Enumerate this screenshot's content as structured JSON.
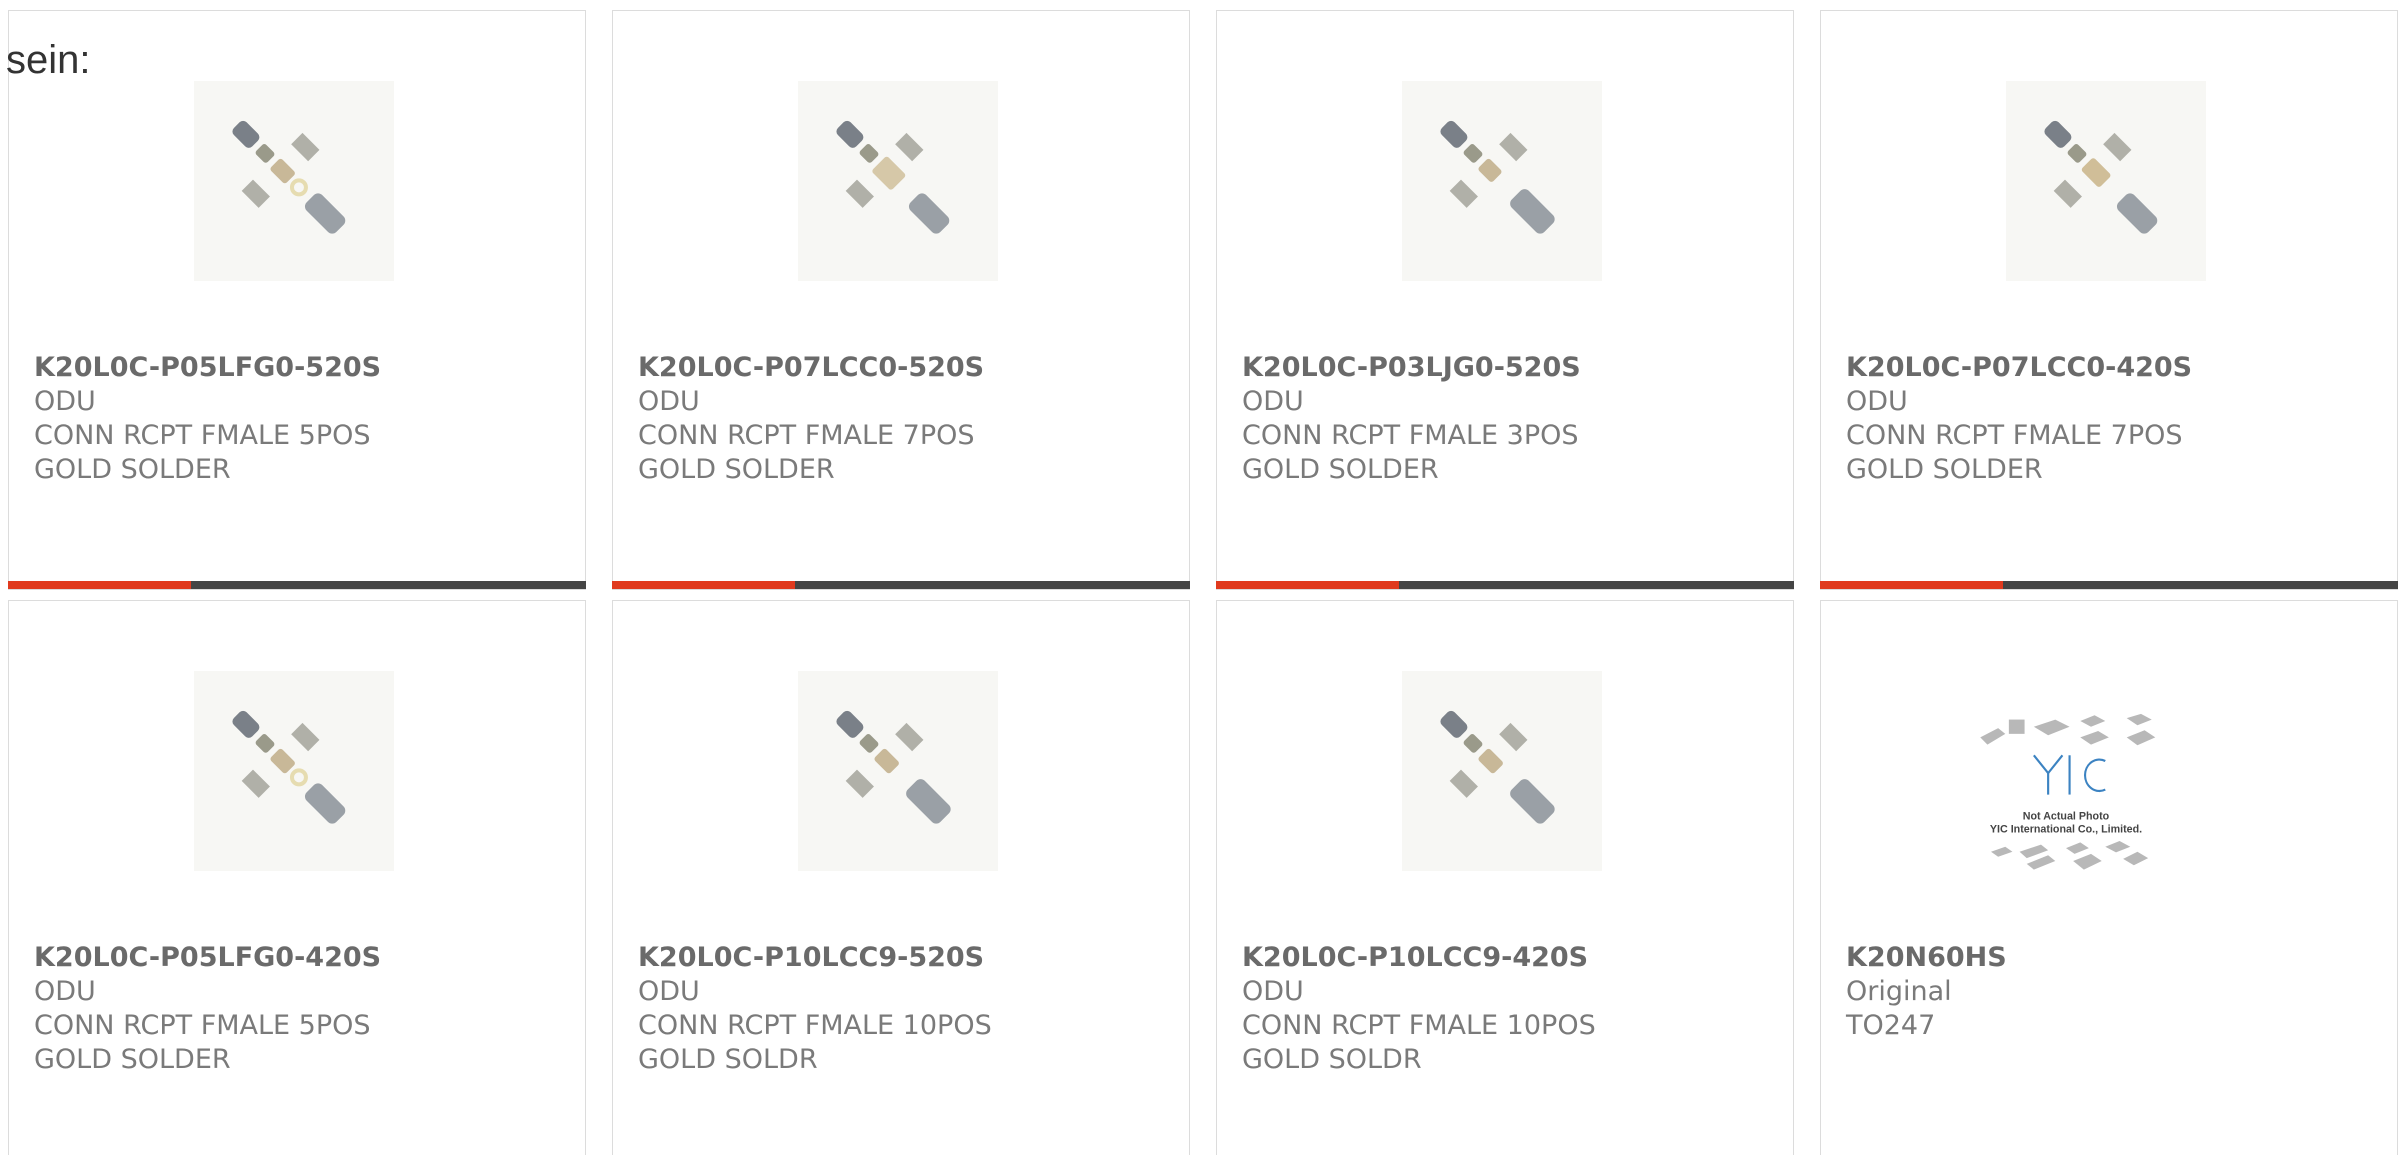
{
  "intro_text": "sein:",
  "colors": {
    "accent": "#e03a1e",
    "bar": "#444444",
    "text": "#7a7a7a",
    "border": "#dcdcdc"
  },
  "products": [
    {
      "part": "K20L0C-P05LFG0-520S",
      "maker": "ODU",
      "desc": "CONN RCPT FMALE 5POS GOLD SOLDER",
      "image": "connector-parts-image"
    },
    {
      "part": "K20L0C-P07LCC0-520S",
      "maker": "ODU",
      "desc": "CONN RCPT FMALE 7POS GOLD SOLDER",
      "image": "connector-parts-image"
    },
    {
      "part": "K20L0C-P03LJG0-520S",
      "maker": "ODU",
      "desc": "CONN RCPT FMALE 3POS GOLD SOLDER",
      "image": "connector-parts-image"
    },
    {
      "part": "K20L0C-P07LCC0-420S",
      "maker": "ODU",
      "desc": "CONN RCPT FMALE 7POS GOLD SOLDER",
      "image": "connector-parts-image"
    },
    {
      "part": "K20L0C-P05LFG0-420S",
      "maker": "ODU",
      "desc": "CONN RCPT FMALE 5POS GOLD SOLDER",
      "image": "connector-parts-image"
    },
    {
      "part": "K20L0C-P10LCC9-520S",
      "maker": "ODU",
      "desc": "CONN RCPT FMALE 10POS GOLD SOLDR",
      "image": "connector-parts-image"
    },
    {
      "part": "K20L0C-P10LCC9-420S",
      "maker": "ODU",
      "desc": "CONN RCPT FMALE 10POS GOLD SOLDR",
      "image": "connector-parts-image"
    },
    {
      "part": "K20N60HS",
      "maker": "Original",
      "desc": "TO247",
      "image": "yic-placeholder-image",
      "image_caption_1": "Not Actual Photo",
      "image_caption_2": "YIC International Co., Limited.",
      "image_logo": "YIC"
    }
  ]
}
